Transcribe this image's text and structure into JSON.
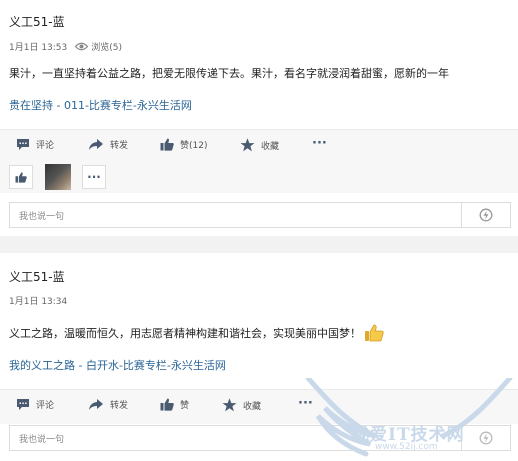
{
  "posts": [
    {
      "author": "义工51-蓝",
      "date": "1月1日 13:53",
      "views": "浏览(5)",
      "content": "果汁，一直坚持着公益之路，把爱无限传递下去。果汁，看名字就浸润着甜蜜，愿新的一年",
      "link": "贵在坚持 - 011-比赛专栏-永兴生活网",
      "actions": {
        "comment": "评论",
        "share": "转发",
        "like": "赞(12)",
        "favorite": "收藏",
        "more": "···"
      },
      "comment_placeholder": "我也说一句"
    },
    {
      "author": "义工51-蓝",
      "date": "1月1日 13:34",
      "content": "义工之路，温暖而恒久，用志愿者精神构建和谐社会，实现美丽中国梦！",
      "link": "我的义工之路 - 白开水-比赛专栏-永兴生活网",
      "actions": {
        "comment": "评论",
        "share": "转发",
        "like": "赞",
        "favorite": "收藏",
        "more": "···"
      },
      "comment_placeholder": "我也说一句"
    }
  ],
  "likers_more": "···",
  "watermark": {
    "text": "我爱IT技术网",
    "url": "www.52ij.com"
  },
  "colors": {
    "link": "#2a6496",
    "action_bar": "#f7f7f7",
    "background": "#f2f2f2"
  },
  "icons": [
    "eye-icon",
    "comment-icon",
    "share-icon",
    "thumbs-up-icon",
    "star-icon",
    "send-icon"
  ]
}
